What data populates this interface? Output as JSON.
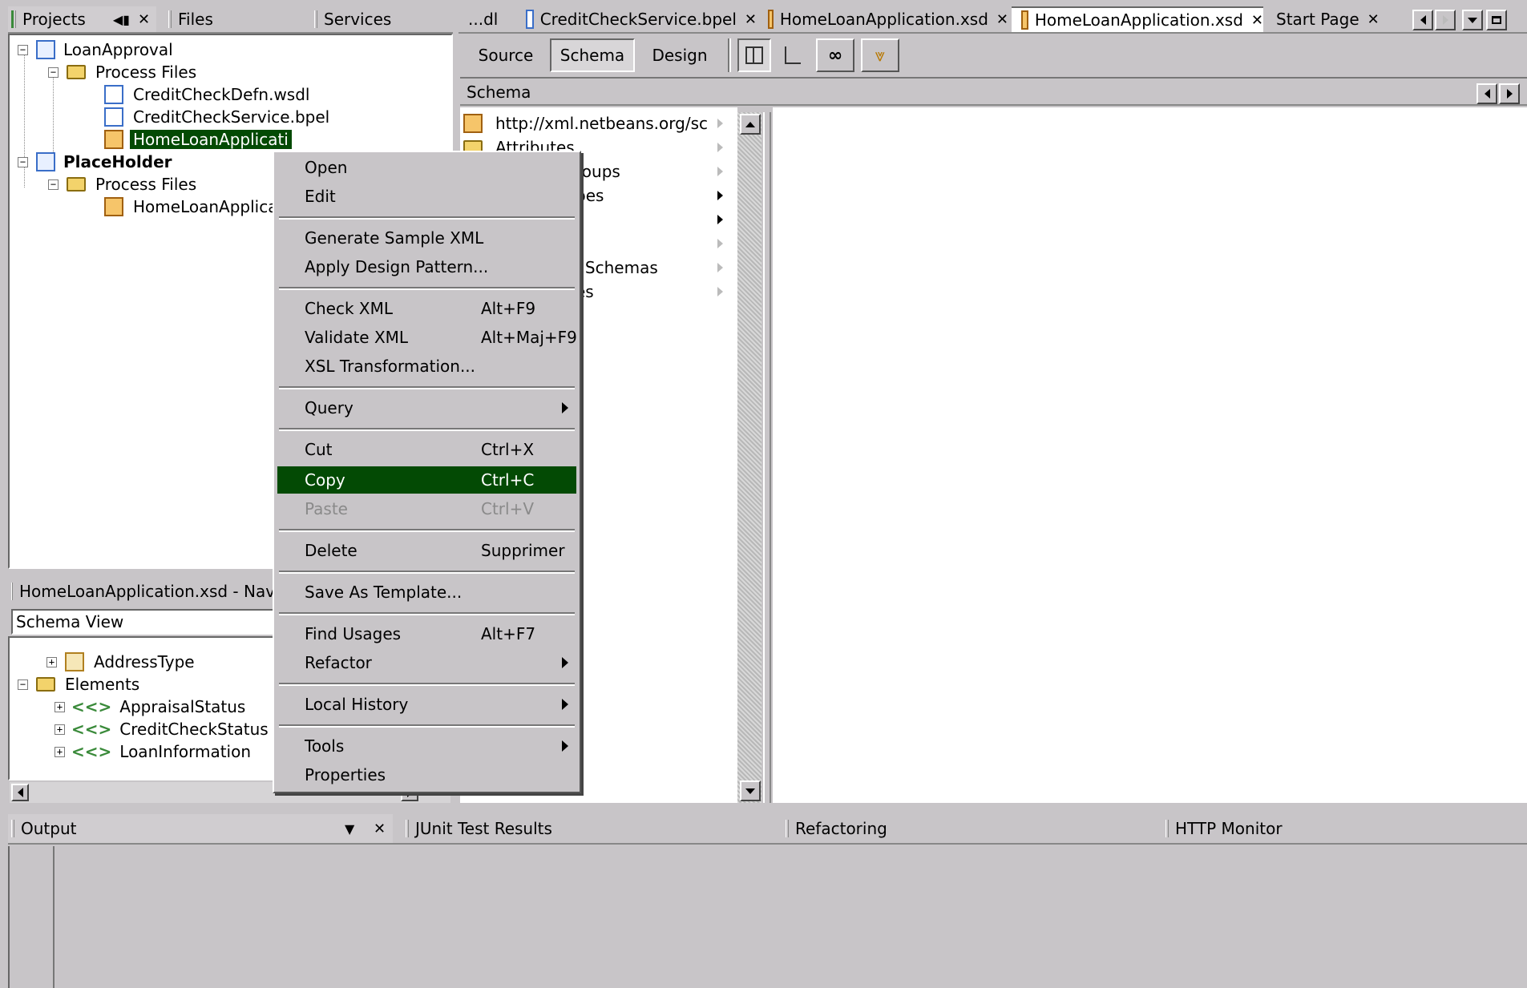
{
  "left_tabs": {
    "projects": "Projects",
    "files": "Files",
    "services": "Services"
  },
  "projects_tree": {
    "root1": "LoanApproval",
    "process_files": "Process Files",
    "wsdl": "CreditCheckDefn.wsdl",
    "bpel": "CreditCheckService.bpel",
    "xsd_selected": "HomeLoanApplicati",
    "root2": "PlaceHolder",
    "process_files2": "Process Files",
    "xsd2": "HomeLoanApplicati"
  },
  "editor_tabs": [
    {
      "label": "...dl"
    },
    {
      "label": "CreditCheckService.bpel"
    },
    {
      "label": "HomeLoanApplication.xsd"
    },
    {
      "label": "HomeLoanApplication.xsd"
    },
    {
      "label": "Start Page"
    }
  ],
  "editor_toolbar": {
    "source": "Source",
    "schema": "Schema",
    "design": "Design"
  },
  "schema_header": "Schema",
  "schema_columns": [
    "http://xml.netbeans.org/sc",
    "Attributes",
    "roups",
    "pes",
    "",
    "",
    "l Schemas",
    "es"
  ],
  "navigator": {
    "title": "HomeLoanApplication.xsd - Naviga",
    "view": "Schema View",
    "items": [
      "AddressType",
      "Elements",
      "AppraisalStatus",
      "CreditCheckStatus",
      "LoanInformation"
    ]
  },
  "context_menu": {
    "open": "Open",
    "edit": "Edit",
    "generate": "Generate Sample XML",
    "apply": "Apply Design Pattern...",
    "check": "Check XML",
    "check_sc": "Alt+F9",
    "validate": "Validate XML",
    "validate_sc": "Alt+Maj+F9",
    "xsl": "XSL Transformation...",
    "query": "Query",
    "cut": "Cut",
    "cut_sc": "Ctrl+X",
    "copy": "Copy",
    "copy_sc": "Ctrl+C",
    "paste": "Paste",
    "paste_sc": "Ctrl+V",
    "delete": "Delete",
    "delete_sc": "Supprimer",
    "save_template": "Save As Template...",
    "find_usages": "Find Usages",
    "find_sc": "Alt+F7",
    "refactor": "Refactor",
    "local_history": "Local History",
    "tools": "Tools",
    "properties": "Properties"
  },
  "bottom_tabs": {
    "output": "Output",
    "junit": "JUnit Test Results",
    "refactoring": "Refactoring",
    "http": "HTTP Monitor"
  },
  "colors": {
    "selection": "#034a04",
    "background": "#c8c5c8"
  }
}
